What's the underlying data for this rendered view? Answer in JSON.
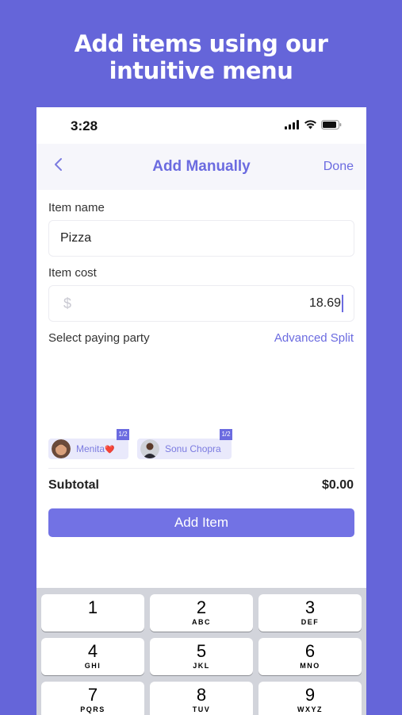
{
  "headline": [
    "Add items using our",
    "intuitive menu"
  ],
  "status_bar": {
    "time": "3:28"
  },
  "nav": {
    "title": "Add Manually",
    "done_label": "Done"
  },
  "form": {
    "item_name_label": "Item name",
    "item_name_value": "Pizza",
    "item_cost_label": "Item cost",
    "currency_symbol": "$",
    "item_cost_value": "18.69",
    "paying_party_label": "Select paying party",
    "advanced_split_label": "Advanced Split"
  },
  "parties": [
    {
      "name": "Menita",
      "emoji": "❤️",
      "fraction": "1/2"
    },
    {
      "name": "Sonu Chopra",
      "emoji": "",
      "fraction": "1/2"
    }
  ],
  "summary": {
    "subtotal_label": "Subtotal",
    "subtotal_value": "$0.00"
  },
  "add_item_label": "Add Item",
  "keypad": [
    {
      "num": "1",
      "letters": ""
    },
    {
      "num": "2",
      "letters": "ABC"
    },
    {
      "num": "3",
      "letters": "DEF"
    },
    {
      "num": "4",
      "letters": "GHI"
    },
    {
      "num": "5",
      "letters": "JKL"
    },
    {
      "num": "6",
      "letters": "MNO"
    },
    {
      "num": "7",
      "letters": "PQRS"
    },
    {
      "num": "8",
      "letters": "TUV"
    },
    {
      "num": "9",
      "letters": "WXYZ"
    }
  ],
  "colors": {
    "background": "#6565d9",
    "accent": "#6b6be0",
    "button": "#7272e4"
  }
}
